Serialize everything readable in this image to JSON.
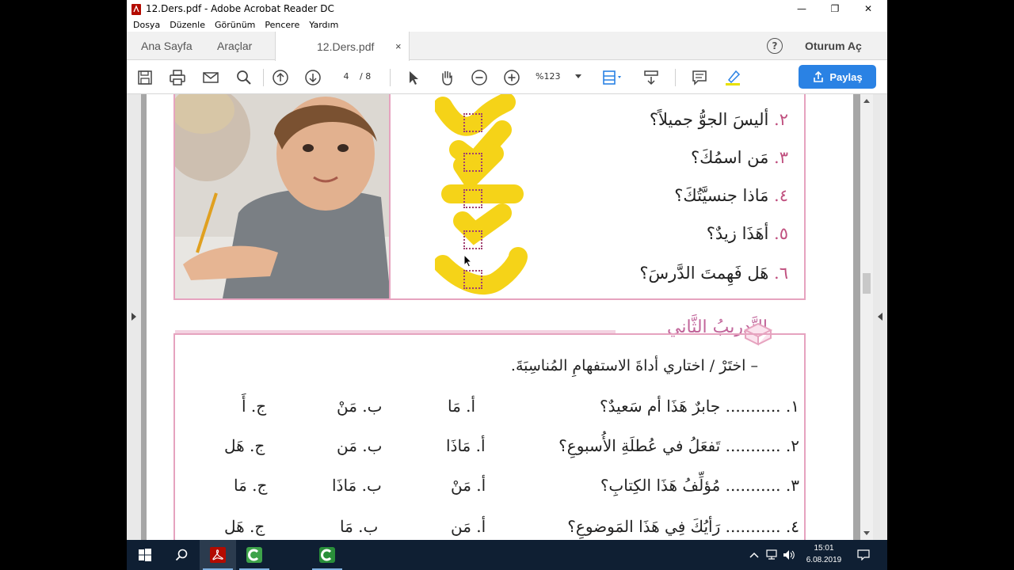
{
  "window": {
    "title": "12.Ders.pdf - Adobe Acrobat Reader DC",
    "minimize": "—",
    "restore": "❐",
    "close": "✕"
  },
  "menu": [
    "Dosya",
    "Düzenle",
    "Görünüm",
    "Pencere",
    "Yardım"
  ],
  "tabs": {
    "home": "Ana Sayfa",
    "tools": "Araçlar",
    "document": "12.Ders.pdf",
    "close_glyph": "×",
    "help": "?",
    "signin": "Oturum Aç"
  },
  "toolbar": {
    "page_current": "4",
    "page_separator": "/ 8",
    "zoom": "%123",
    "share": "Paylaş",
    "icons": [
      "save-icon",
      "print-icon",
      "mail-icon",
      "search-icon",
      "page-up-icon",
      "page-down-icon",
      "select-icon",
      "hand-icon",
      "zoom-out-icon",
      "zoom-in-icon",
      "fit-page-icon",
      "scroll-mode-icon",
      "comment-icon",
      "highlight-icon"
    ],
    "accent": "#2a82e4"
  },
  "exercise1": {
    "questions": [
      {
        "num": "٢.",
        "text": " أليسَ الجوُّ جميلاً؟"
      },
      {
        "num": "٣.",
        "text": " مَن اسمُكَ؟"
      },
      {
        "num": "٤.",
        "text": " مَاذا جنسيَّتُكَ؟"
      },
      {
        "num": "٥.",
        "text": " أهَذَا زيدٌ؟"
      },
      {
        "num": "٦.",
        "text": " هَل فَهِمتَ الدَّرسَ؟"
      }
    ]
  },
  "exercise2": {
    "title": "التَّدريبُ الثَّاني",
    "instruction": "– اختَرْ / اختاري أداةَ الاستفهامِ المُناسِبَةَ.",
    "rows": [
      {
        "q": "١. ........... جابرٌ هَذَا أم سَعيدٌ؟",
        "a": "أ. مَا",
        "b": "ب. مَنْ",
        "c": "ج. أَ"
      },
      {
        "q": "٢. ........... تَفعَلُ في عُطلَةِ الأُسبوعِ؟",
        "a": "أ. مَاذَا",
        "b": "ب. مَن",
        "c": "ج. هَل"
      },
      {
        "q": "٣. ........... مُؤلِّفُ هَذَا الكِتابِ؟",
        "a": "أ. مَنْ",
        "b": "ب. مَاذَا",
        "c": "ج. مَا"
      },
      {
        "q": "٤. ........... رَأيُكَ فِي هَذَا المَوضوعِ؟",
        "a": "أ. مَن",
        "b": "ب. مَا",
        "c": "ج. هَل"
      }
    ]
  },
  "taskbar": {
    "time": "15:01",
    "date": "6.08.2019",
    "icons": [
      "windows-start-icon",
      "search-icon",
      "acrobat-icon",
      "camtasia-icon",
      "camtasia-recorder-icon"
    ]
  }
}
